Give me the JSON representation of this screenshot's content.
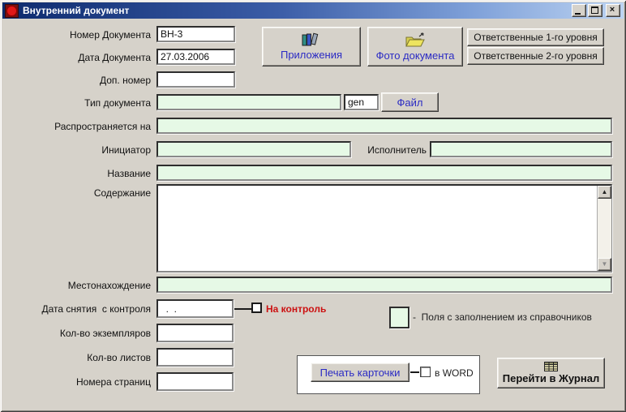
{
  "window": {
    "title": "Внутренний документ"
  },
  "titlebar_icons": {
    "close": "×"
  },
  "form": {
    "doc_number": {
      "label": "Номер Документа",
      "value": "ВН-3"
    },
    "doc_date": {
      "label": "Дата Документа",
      "value": "27.03.2006"
    },
    "extra_number": {
      "label": "Доп. номер",
      "value": ""
    },
    "doc_type": {
      "label": "Тип документа",
      "value": ""
    },
    "file_type": {
      "value": "gen"
    },
    "applies_to": {
      "label": "Распространяется на",
      "value": ""
    },
    "initiator": {
      "label": "Инициатор",
      "value": ""
    },
    "executor": {
      "label": "Исполнитель",
      "value": ""
    },
    "doc_title": {
      "label": "Название",
      "value": ""
    },
    "content": {
      "label": "Содержание",
      "value": ""
    },
    "location": {
      "label": "Местонахождение",
      "value": ""
    },
    "control_release_date": {
      "label": "Дата снятия  с контроля",
      "value": "  .  ."
    },
    "on_control": {
      "label": "На контроль",
      "checked": false
    },
    "copies_count": {
      "label": "Кол-во экземпляров",
      "value": ""
    },
    "sheets_count": {
      "label": "Кол-во листов",
      "value": ""
    },
    "page_numbers": {
      "label": "Номера страниц",
      "value": ""
    },
    "in_word": {
      "label": "в WORD",
      "checked": false
    }
  },
  "buttons": {
    "attachments": "Приложения",
    "photo": "Фото документа",
    "responsible_level1": "Ответственные 1-го уровня",
    "responsible_level2": "Ответственные 2-го уровня",
    "file": "Файл",
    "print_card": "Печать карточки",
    "go_to_journal": "Перейти в Журнал"
  },
  "legend": {
    "note": "-  Поля с заполнением из справочников"
  },
  "scrollbar": {
    "up": "▲",
    "down": "▼"
  },
  "colors": {
    "titlebar_gradient_start": "#0d2a6e",
    "titlebar_gradient_end": "#bdd4f2",
    "window_face": "#d6d2ca",
    "reference_field_green": "#e6f9e6",
    "accent_blue_text": "#2b2bc4",
    "alert_red_text": "#cc1111"
  }
}
